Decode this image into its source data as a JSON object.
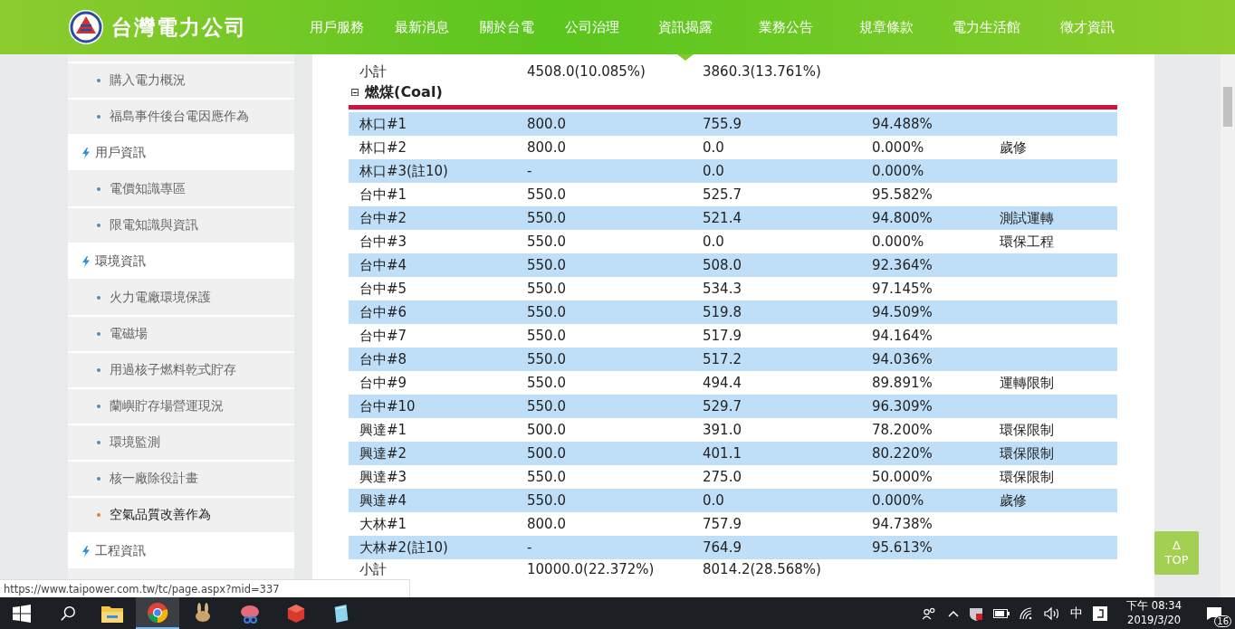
{
  "header": {
    "brand": "台灣電力公司",
    "nav": [
      {
        "label": "用戶服務",
        "selected": false
      },
      {
        "label": "最新消息",
        "selected": false
      },
      {
        "label": "關於台電",
        "selected": false
      },
      {
        "label": "公司治理",
        "selected": false
      },
      {
        "label": "資訊揭露",
        "selected": true
      },
      {
        "label": "業務公告",
        "selected": false
      },
      {
        "label": "規章條款",
        "selected": false
      },
      {
        "label": "電力生活館",
        "selected": false
      },
      {
        "label": "徵才資訊",
        "selected": false
      }
    ]
  },
  "sidebar": {
    "items": [
      {
        "kind": "sub",
        "label": "購入電力概況",
        "selected": false
      },
      {
        "kind": "sub",
        "label": "福島事件後台電因應作為",
        "selected": false
      },
      {
        "kind": "section",
        "label": "用戶資訊",
        "selected": false
      },
      {
        "kind": "sub",
        "label": "電價知識專區",
        "selected": false
      },
      {
        "kind": "sub",
        "label": "限電知識與資訊",
        "selected": false
      },
      {
        "kind": "section",
        "label": "環境資訊",
        "selected": false
      },
      {
        "kind": "sub",
        "label": "火力電廠環境保護",
        "selected": false
      },
      {
        "kind": "sub",
        "label": "電磁場",
        "selected": false
      },
      {
        "kind": "sub",
        "label": "用過核子燃料乾式貯存",
        "selected": false
      },
      {
        "kind": "sub",
        "label": "蘭嶼貯存場營運現況",
        "selected": false
      },
      {
        "kind": "sub",
        "label": "環境監測",
        "selected": false
      },
      {
        "kind": "sub",
        "label": "核一廠除役計畫",
        "selected": false
      },
      {
        "kind": "sub",
        "label": "空氣品質改善作為",
        "selected": true
      },
      {
        "kind": "section",
        "label": "工程資訊",
        "selected": false
      }
    ]
  },
  "table": {
    "top_subtotal": [
      "小計",
      "4508.0(10.085%)",
      "3860.3(13.761%)"
    ],
    "section": {
      "toggle": "⊟",
      "title": "燃煤(Coal)"
    },
    "rows": [
      [
        "林口#1",
        "800.0",
        "755.9",
        "94.488%",
        ""
      ],
      [
        "林口#2",
        "800.0",
        "0.0",
        "0.000%",
        "歲修"
      ],
      [
        "林口#3(註10)",
        "-",
        "0.0",
        "0.000%",
        ""
      ],
      [
        "台中#1",
        "550.0",
        "525.7",
        "95.582%",
        ""
      ],
      [
        "台中#2",
        "550.0",
        "521.4",
        "94.800%",
        "測試運轉"
      ],
      [
        "台中#3",
        "550.0",
        "0.0",
        "0.000%",
        "環保工程"
      ],
      [
        "台中#4",
        "550.0",
        "508.0",
        "92.364%",
        ""
      ],
      [
        "台中#5",
        "550.0",
        "534.3",
        "97.145%",
        ""
      ],
      [
        "台中#6",
        "550.0",
        "519.8",
        "94.509%",
        ""
      ],
      [
        "台中#7",
        "550.0",
        "517.9",
        "94.164%",
        ""
      ],
      [
        "台中#8",
        "550.0",
        "517.2",
        "94.036%",
        ""
      ],
      [
        "台中#9",
        "550.0",
        "494.4",
        "89.891%",
        "運轉限制"
      ],
      [
        "台中#10",
        "550.0",
        "529.7",
        "96.309%",
        ""
      ],
      [
        "興達#1",
        "500.0",
        "391.0",
        "78.200%",
        "環保限制"
      ],
      [
        "興達#2",
        "500.0",
        "401.1",
        "80.220%",
        "環保限制"
      ],
      [
        "興達#3",
        "550.0",
        "275.0",
        "50.000%",
        "環保限制"
      ],
      [
        "興達#4",
        "550.0",
        "0.0",
        "0.000%",
        "歲修"
      ],
      [
        "大林#1",
        "800.0",
        "757.9",
        "94.738%",
        ""
      ],
      [
        "大林#2(註10)",
        "-",
        "764.9",
        "95.613%",
        ""
      ]
    ],
    "subtotal": [
      "小計",
      "10000.0(22.372%)",
      "8014.2(28.568%)"
    ]
  },
  "top_button": {
    "arrow": "Δ",
    "label": "TOP"
  },
  "status_url": "https://www.taipower.com.tw/tc/page.aspx?mid=337",
  "taskbar": {
    "ime": "中",
    "time": "下午 08:34",
    "date": "2019/3/20",
    "notifications": "16"
  }
}
